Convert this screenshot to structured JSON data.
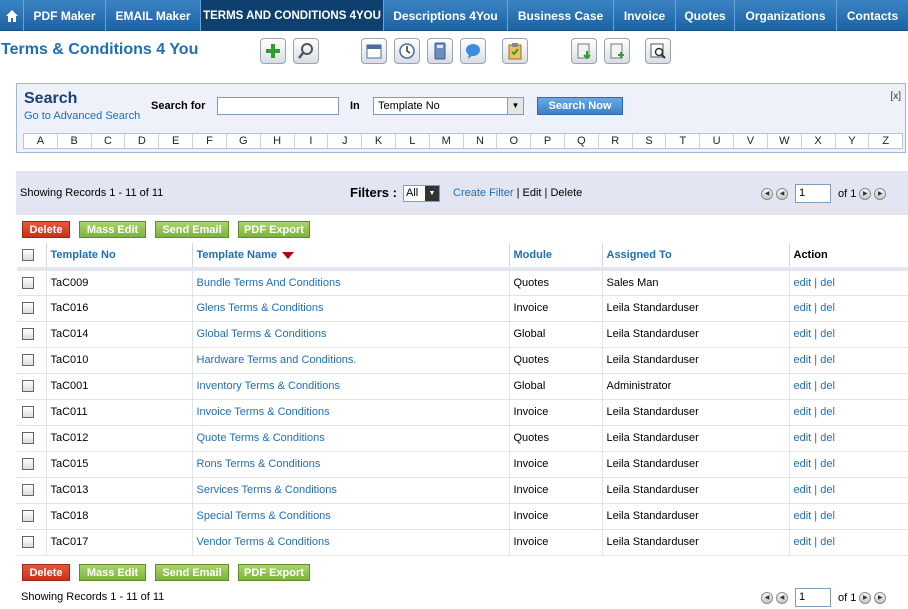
{
  "nav": {
    "tabs": [
      {
        "label": "PDF Maker",
        "active": false
      },
      {
        "label": "EMAIL Maker",
        "active": false
      },
      {
        "label": "TERMS AND CONDITIONS 4YOU",
        "active": true
      },
      {
        "label": "Descriptions 4You",
        "active": false
      },
      {
        "label": "Business Case",
        "active": false
      },
      {
        "label": "Invoice",
        "active": false
      },
      {
        "label": "Quotes",
        "active": false
      },
      {
        "label": "Organizations",
        "active": false
      },
      {
        "label": "Contacts",
        "active": false
      }
    ]
  },
  "header": {
    "title": "Terms & Conditions 4 You"
  },
  "toolbar_icons": [
    "add-icon",
    "search-icon",
    "calendar-icon",
    "clock-icon",
    "calculator-icon",
    "chat-icon",
    "clipboard-icon",
    "import-icon",
    "export-icon",
    "find-duplicates-icon"
  ],
  "search": {
    "title": "Search",
    "advanced_link": "Go to Advanced Search",
    "search_for_label": "Search for",
    "search_value": "",
    "in_label": "In",
    "in_selected": "Template No",
    "button": "Search Now",
    "close": "[x]",
    "alphabet": [
      "A",
      "B",
      "C",
      "D",
      "E",
      "F",
      "G",
      "H",
      "I",
      "J",
      "K",
      "L",
      "M",
      "N",
      "O",
      "P",
      "Q",
      "R",
      "S",
      "T",
      "U",
      "V",
      "W",
      "X",
      "Y",
      "Z"
    ]
  },
  "records": {
    "text": "Showing Records 1 - 11 of 11",
    "filters_label": "Filters :",
    "filter_selected": "All",
    "create_filter": "Create Filter",
    "sep1": " | ",
    "edit": "Edit",
    "sep2": " | ",
    "delete": "Delete",
    "page": "1",
    "of_pages": "of 1"
  },
  "buttons": {
    "delete": "Delete",
    "mass_edit": "Mass Edit",
    "send_email": "Send Email",
    "pdf_export": "PDF Export"
  },
  "table": {
    "headers": {
      "template_no": "Template No",
      "template_name": "Template Name",
      "module": "Module",
      "assigned_to": "Assigned To",
      "action": "Action"
    },
    "rows": [
      {
        "no": "TaC009",
        "name": "Bundle Terms And Conditions",
        "module": "Quotes",
        "assigned": "Sales Man",
        "action": "edit | del"
      },
      {
        "no": "TaC016",
        "name": "Glens Terms & Conditions",
        "module": "Invoice",
        "assigned": "Leila Standarduser",
        "action": "edit | del"
      },
      {
        "no": "TaC014",
        "name": "Global Terms & Conditions",
        "module": "Global",
        "assigned": "Leila Standarduser",
        "action": "edit | del"
      },
      {
        "no": "TaC010",
        "name": "Hardware Terms and Conditions.",
        "module": "Quotes",
        "assigned": "Leila Standarduser",
        "action": "edit | del"
      },
      {
        "no": "TaC001",
        "name": "Inventory Terms & Conditions",
        "module": "Global",
        "assigned": "Administrator",
        "action": "edit | del"
      },
      {
        "no": "TaC011",
        "name": "Invoice Terms & Conditions",
        "module": "Invoice",
        "assigned": "Leila Standarduser",
        "action": "edit | del"
      },
      {
        "no": "TaC012",
        "name": "Quote Terms & Conditions",
        "module": "Quotes",
        "assigned": "Leila Standarduser",
        "action": "edit | del"
      },
      {
        "no": "TaC015",
        "name": "Rons Terms & Conditions",
        "module": "Invoice",
        "assigned": "Leila Standarduser",
        "action": "edit | del"
      },
      {
        "no": "TaC013",
        "name": "Services Terms & Conditions",
        "module": "Invoice",
        "assigned": "Leila Standarduser",
        "action": "edit | del"
      },
      {
        "no": "TaC018",
        "name": "Special Terms & Conditions",
        "module": "Invoice",
        "assigned": "Leila Standarduser",
        "action": "edit | del"
      },
      {
        "no": "TaC017",
        "name": "Vendor Terms & Conditions",
        "module": "Invoice",
        "assigned": "Leila Standarduser",
        "action": "edit | del"
      }
    ]
  },
  "footer": {
    "records_text": "Showing Records 1 - 11 of 11",
    "page": "1",
    "of_pages": "of 1"
  }
}
